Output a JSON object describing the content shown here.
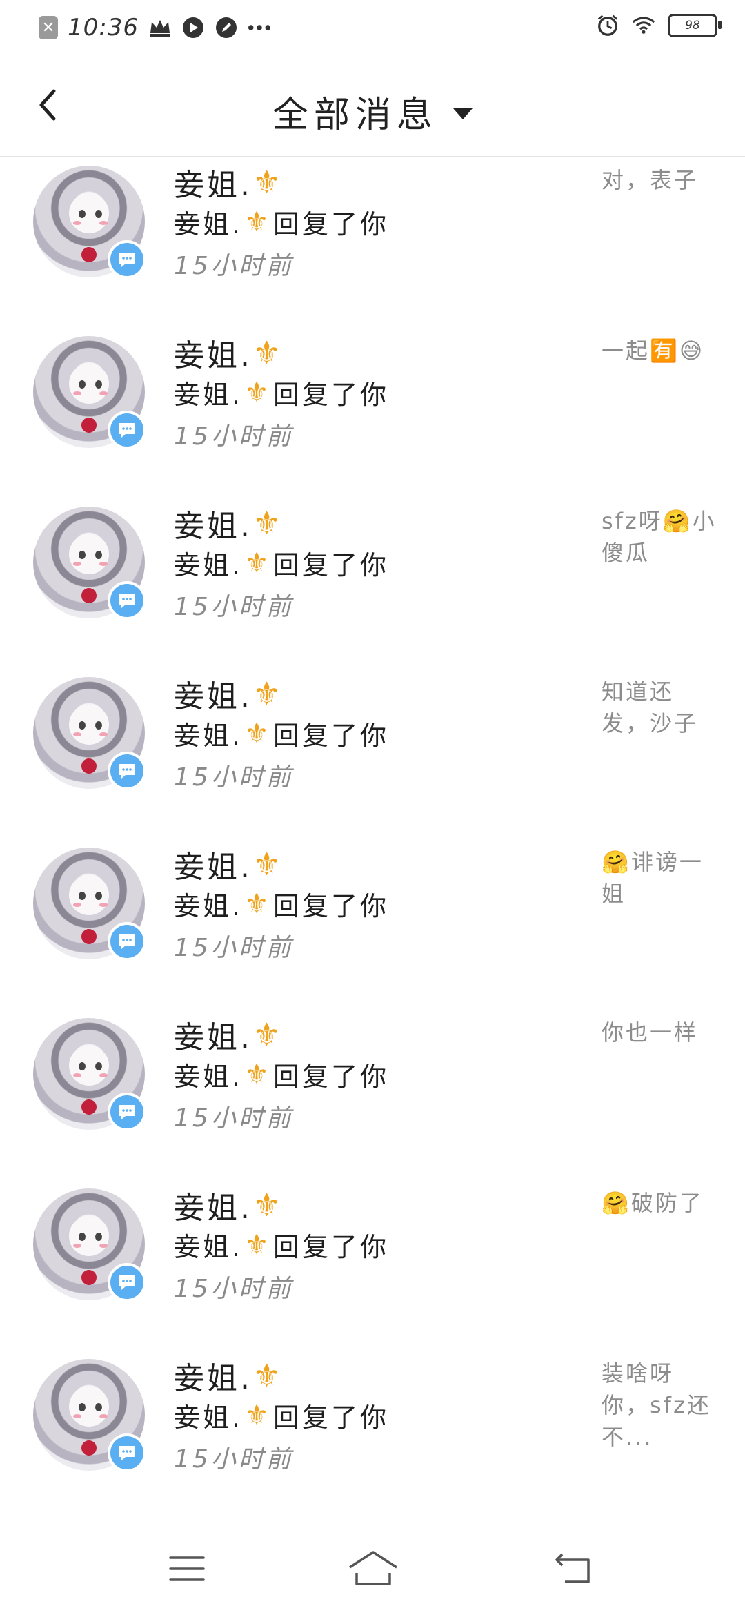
{
  "status_bar": {
    "time": "10:36",
    "battery": "98",
    "icons": [
      "close-notification-icon",
      "crown-icon",
      "play-icon",
      "pencil-icon",
      "more-icon",
      "alarm-icon",
      "wifi-icon",
      "battery-icon"
    ]
  },
  "header": {
    "title": "全部消息",
    "back_icon": "chevron-left-icon",
    "dropdown_icon": "caret-down-icon"
  },
  "messages": [
    {
      "name": "妾姐.",
      "reply": "妾姐.",
      "reply_suffix": "回复了你",
      "time": "15小时前",
      "preview": "对，表子"
    },
    {
      "name": "妾姐.",
      "reply": "妾姐.",
      "reply_suffix": "回复了你",
      "time": "15小时前",
      "preview": "一起🈶😅"
    },
    {
      "name": "妾姐.",
      "reply": "妾姐.",
      "reply_suffix": "回复了你",
      "time": "15小时前",
      "preview": "sfz呀🤗小傻瓜"
    },
    {
      "name": "妾姐.",
      "reply": "妾姐.",
      "reply_suffix": "回复了你",
      "time": "15小时前",
      "preview": "知道还发，沙子"
    },
    {
      "name": "妾姐.",
      "reply": "妾姐.",
      "reply_suffix": "回复了你",
      "time": "15小时前",
      "preview": "🤗诽谤一姐"
    },
    {
      "name": "妾姐.",
      "reply": "妾姐.",
      "reply_suffix": "回复了你",
      "time": "15小时前",
      "preview": "你也一样"
    },
    {
      "name": "妾姐.",
      "reply": "妾姐.",
      "reply_suffix": "回复了你",
      "time": "15小时前",
      "preview": "🤗破防了"
    },
    {
      "name": "妾姐.",
      "reply": "妾姐.",
      "reply_suffix": "回复了你",
      "time": "15小时前",
      "preview": "装啥呀你，sfz还不..."
    }
  ],
  "nav_bar": {
    "icons": [
      "menu-icon",
      "home-icon",
      "back-icon"
    ]
  },
  "colors": {
    "badge": "#5aaef2",
    "fleur": "#f0a21a",
    "muted_text": "#8c8c8c"
  }
}
